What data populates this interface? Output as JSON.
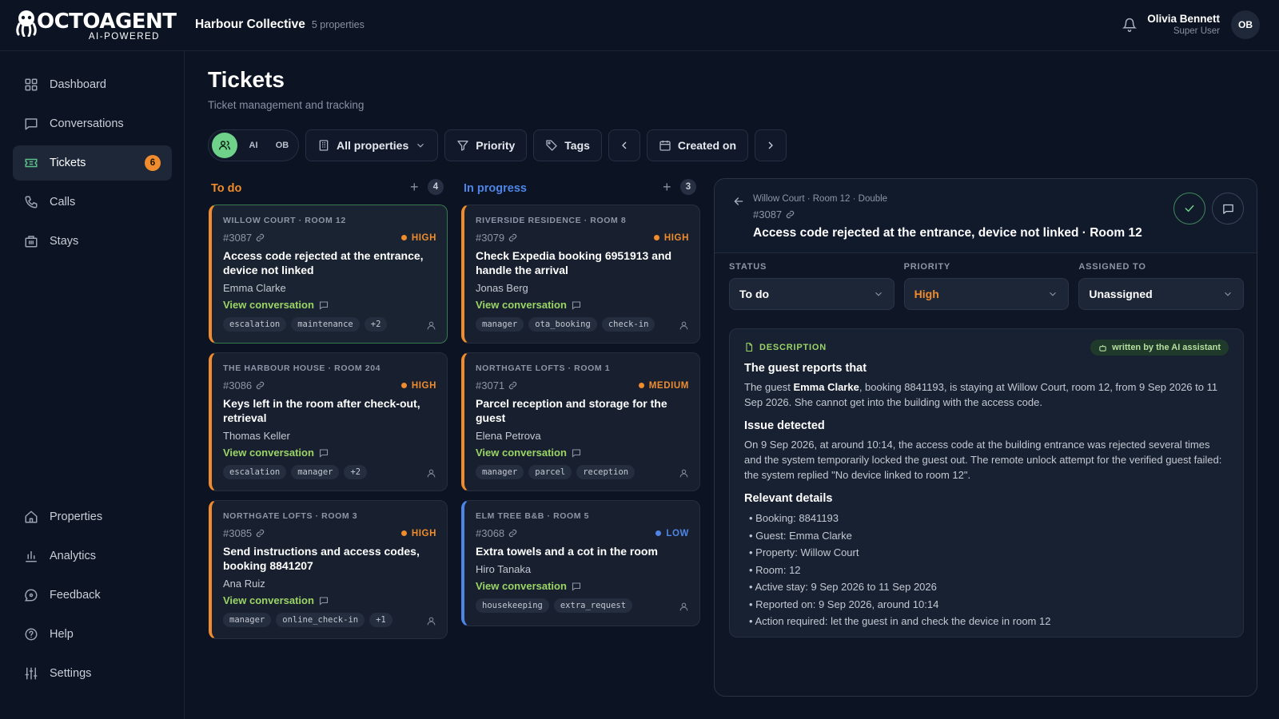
{
  "brand": {
    "name": "OCTOAGENT",
    "tagline": "AI-POWERED"
  },
  "org": {
    "name": "Harbour Collective",
    "subtitle": "5 properties"
  },
  "user": {
    "name": "Olivia Bennett",
    "role": "Super User",
    "initials": "OB"
  },
  "sidebar": {
    "top": [
      {
        "label": "Dashboard",
        "icon": "grid-icon"
      },
      {
        "label": "Conversations",
        "icon": "chat-icon"
      },
      {
        "label": "Tickets",
        "icon": "ticket-icon",
        "badge": "6",
        "active": true
      },
      {
        "label": "Calls",
        "icon": "phone-icon"
      },
      {
        "label": "Stays",
        "icon": "building-icon"
      }
    ],
    "bottom": [
      {
        "label": "Properties",
        "icon": "home-icon"
      },
      {
        "label": "Analytics",
        "icon": "bar-chart-icon"
      },
      {
        "label": "Feedback",
        "icon": "feedback-icon"
      },
      {
        "label": "Help",
        "icon": "help-icon"
      },
      {
        "label": "Settings",
        "icon": "sliders-icon"
      }
    ]
  },
  "page": {
    "title": "Tickets",
    "subtitle": "Ticket management and tracking"
  },
  "toolbar": {
    "assignees": [
      "AI",
      "OB"
    ],
    "properties_label": "All properties",
    "priority_label": "Priority",
    "tags_label": "Tags",
    "created_label": "Created on"
  },
  "columns": {
    "todo": {
      "title": "To do",
      "count": "4",
      "color": "#f08c2e"
    },
    "progress": {
      "title": "In progress",
      "count": "3",
      "color": "#4f85e6"
    }
  },
  "view_conversation": "View conversation",
  "priority_colors": {
    "HIGH": "#f08c2e",
    "MEDIUM": "#f08c2e",
    "LOW": "#4f85e6"
  },
  "tickets": {
    "todo": [
      {
        "location": "WILLOW COURT · ROOM 12",
        "id": "#3087",
        "priority": "HIGH",
        "title": "Access code rejected at the entrance, device not linked",
        "guest": "Emma Clarke",
        "tags": [
          "escalation",
          "maintenance",
          "+2"
        ]
      },
      {
        "location": "THE HARBOUR HOUSE · ROOM 204",
        "id": "#3086",
        "priority": "HIGH",
        "title": "Keys left in the room after check-out, retrieval",
        "guest": "Thomas Keller",
        "tags": [
          "escalation",
          "manager",
          "+2"
        ]
      },
      {
        "location": "NORTHGATE LOFTS · ROOM 3",
        "id": "#3085",
        "priority": "HIGH",
        "title": "Send instructions and access codes, booking 8841207",
        "guest": "Ana Ruiz",
        "tags": [
          "manager",
          "online_check-in",
          "+1"
        ]
      }
    ],
    "progress": [
      {
        "location": "RIVERSIDE RESIDENCE · ROOM 8",
        "id": "#3079",
        "priority": "HIGH",
        "title": "Check Expedia booking 6951913 and handle the arrival",
        "guest": "Jonas Berg",
        "tags": [
          "manager",
          "ota_booking",
          "check-in"
        ]
      },
      {
        "location": "NORTHGATE LOFTS · ROOM 1",
        "id": "#3071",
        "priority": "MEDIUM",
        "title": "Parcel reception and storage for the guest",
        "guest": "Elena Petrova",
        "tags": [
          "manager",
          "parcel",
          "reception"
        ]
      },
      {
        "location": "ELM TREE B&B · ROOM 5",
        "id": "#3068",
        "priority": "LOW",
        "title": "Extra towels and a cot in the room",
        "guest": "Hiro Tanaka",
        "tags": [
          "housekeeping",
          "extra_request"
        ]
      }
    ]
  },
  "detail": {
    "breadcrumb": "Willow Court · Room 12 · Double",
    "id": "#3087",
    "title": "Access code rejected at the entrance, device not linked · Room 12",
    "status_label": "STATUS",
    "status": "To do",
    "priority_label": "PRIORITY",
    "priority": "High",
    "priority_color": "#f08c2e",
    "assigned_label": "ASSIGNED TO",
    "assigned": "Unassigned",
    "desc_label": "DESCRIPTION",
    "ai_badge": "written by the AI assistant",
    "h1": "The guest reports that",
    "p1_a": "The guest ",
    "p1_name": "Emma Clarke",
    "p1_b": ", booking 8841193, is staying at Willow Court, room 12, from 9 Sep 2026 to 11 Sep 2026. She cannot get into the building with the access code.",
    "h2": "Issue detected",
    "p2": "On 9 Sep 2026, at around 10:14, the access code at the building entrance was rejected several times and the system temporarily locked the guest out. The remote unlock attempt for the verified guest failed: the system replied \"No device linked to room 12\".",
    "h3": "Relevant details",
    "details": [
      "Booking: 8841193",
      "Guest: Emma Clarke",
      "Property: Willow Court",
      "Room: 12",
      "Active stay: 9 Sep 2026 to 11 Sep 2026",
      "Reported on: 9 Sep 2026, around 10:14",
      "Action required: let the guest in and check the device in room 12"
    ]
  }
}
